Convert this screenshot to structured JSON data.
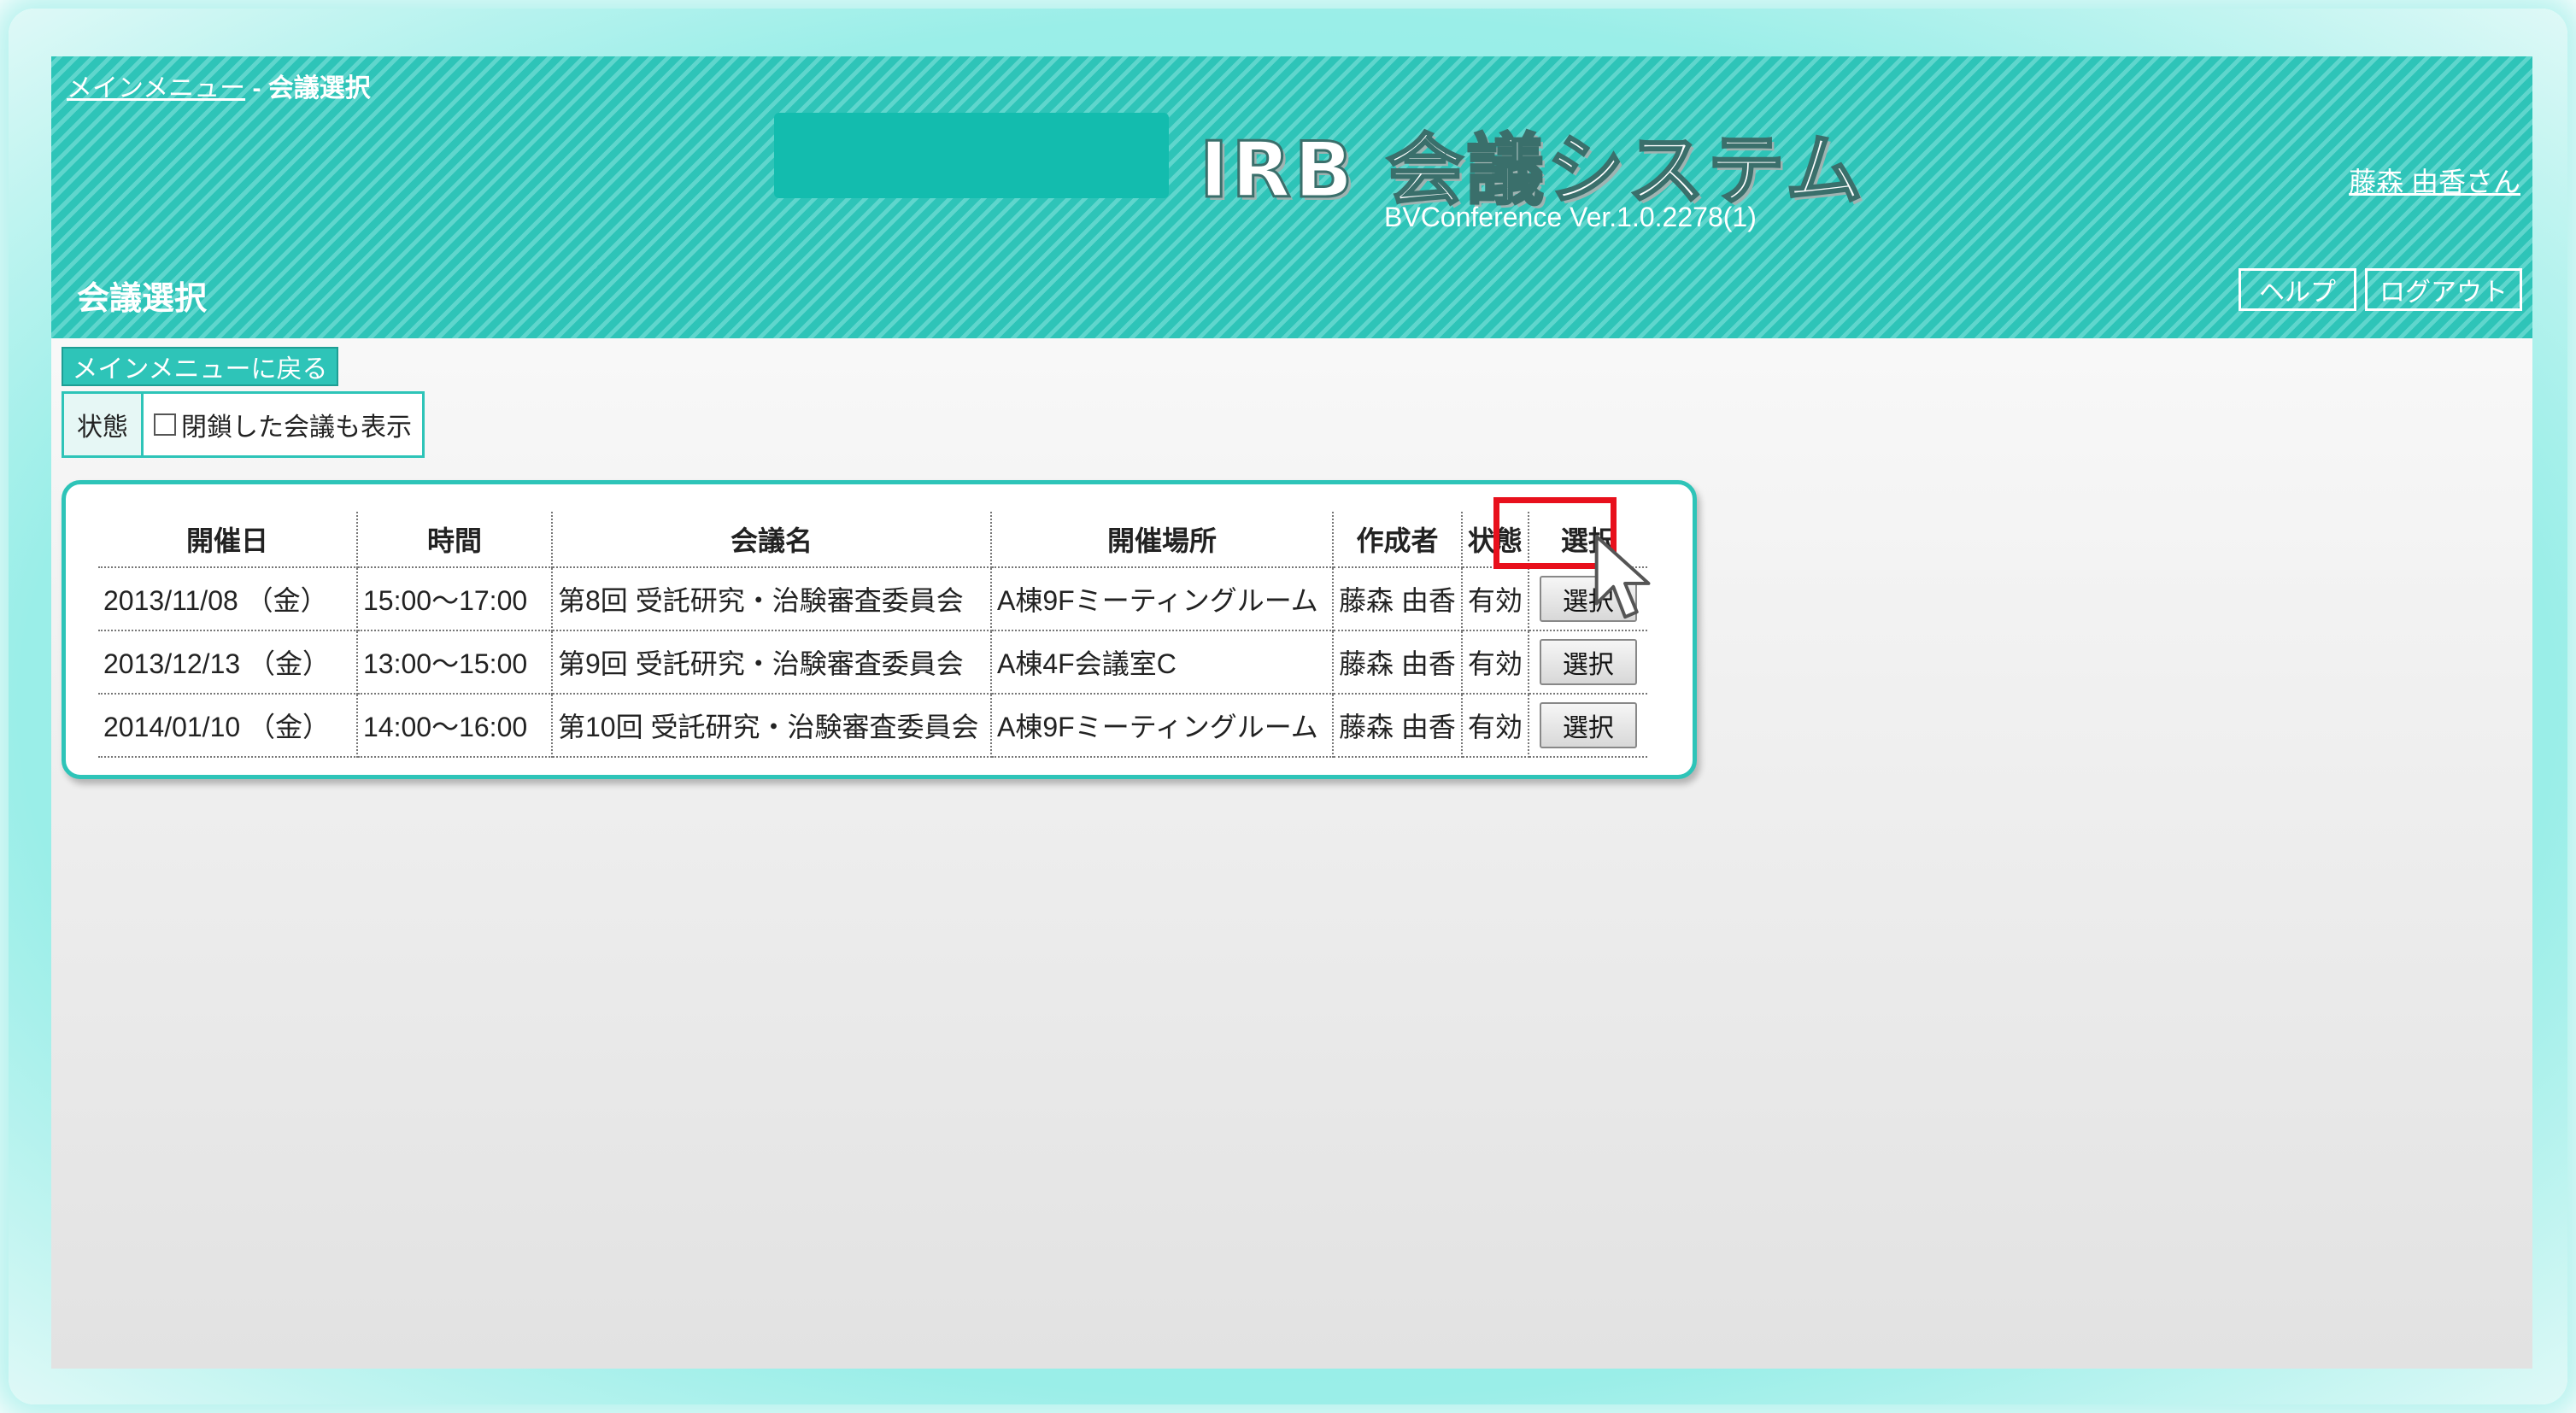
{
  "breadcrumb": {
    "main_menu": "メインメニュー",
    "separator": " - ",
    "current": "会議選択"
  },
  "app": {
    "title": "IRB 会議システム",
    "version": "BVConference Ver.1.0.2278(1)"
  },
  "user": {
    "name": "藤森 由香さん"
  },
  "page": {
    "heading": "会議選択"
  },
  "header_buttons": {
    "help": "ヘルプ",
    "logout": "ログアウト"
  },
  "back_button": "メインメニューに戻る",
  "filter": {
    "label": "状態",
    "option": "閉鎖した会議も表示",
    "checked": false
  },
  "table": {
    "headers": [
      "開催日",
      "時間",
      "会議名",
      "開催場所",
      "作成者",
      "状態",
      "選択"
    ],
    "rows": [
      {
        "date": "2013/11/08 （金）",
        "time": "15:00～17:00",
        "name": "第8回 受託研究・治験審査委員会",
        "place": "A棟9Fミーティングルーム",
        "creator": "藤森 由香",
        "status": "有効",
        "select": "選択"
      },
      {
        "date": "2013/12/13 （金）",
        "time": "13:00～15:00",
        "name": "第9回 受託研究・治験審査委員会",
        "place": "A棟4F会議室C",
        "creator": "藤森 由香",
        "status": "有効",
        "select": "選択"
      },
      {
        "date": "2014/01/10 （金）",
        "time": "14:00～16:00",
        "name": "第10回 受託研究・治験審査委員会",
        "place": "A棟9Fミーティングルーム",
        "creator": "藤森 由香",
        "status": "有効",
        "select": "選択"
      }
    ]
  },
  "colors": {
    "accent": "#2ec4b8",
    "highlight": "#e8101c"
  }
}
